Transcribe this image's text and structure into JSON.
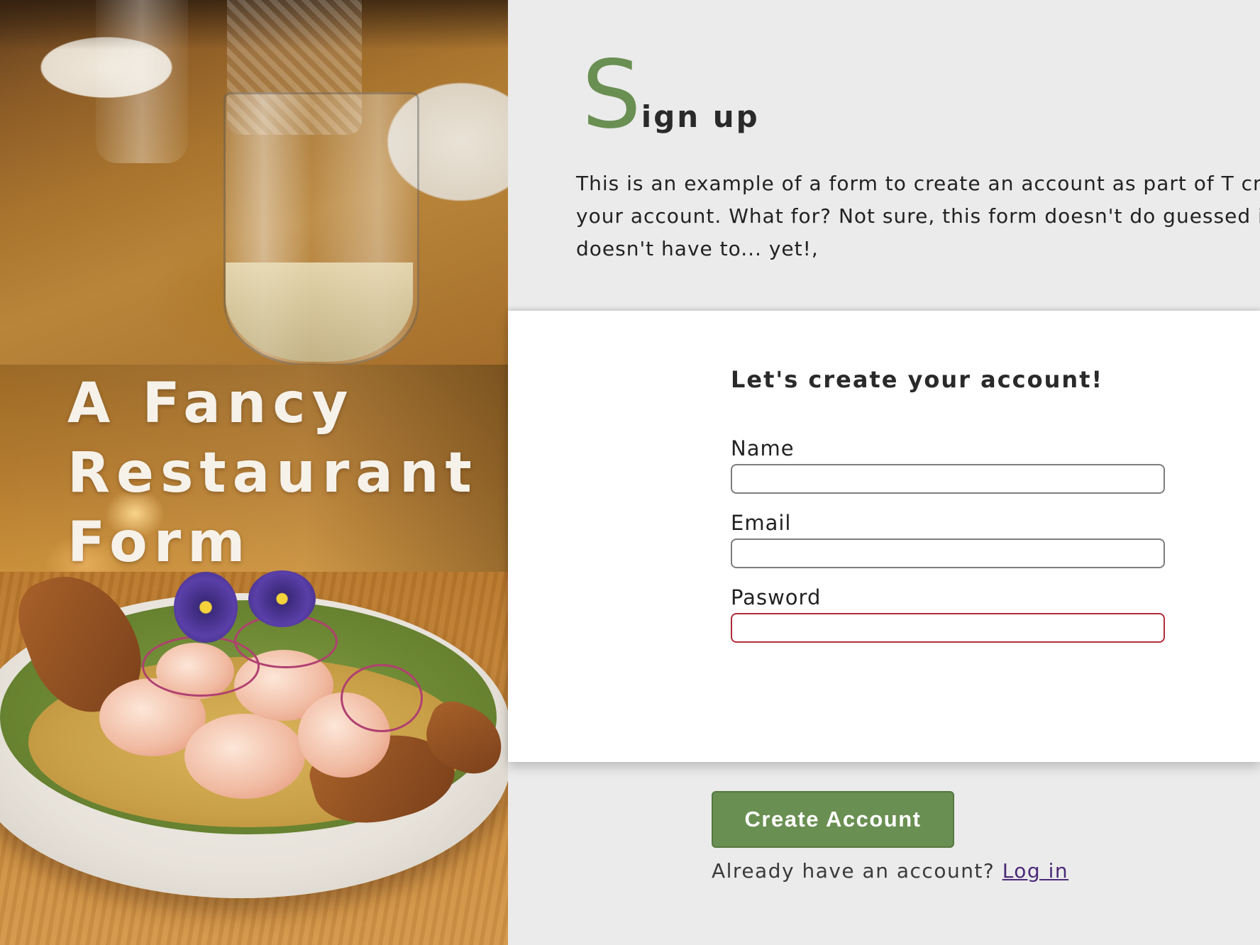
{
  "hero": {
    "title_line1": "A Fancy",
    "title_line2": "Restaurant",
    "title_line3": "Form"
  },
  "header": {
    "title_initial": "S",
    "title_rest": "ign up",
    "intro_text": "This is an example of a form to create an account as part of T create your account. What for? Not sure, this form doesn't do guessed it... it doesn't have to... yet!,"
  },
  "form": {
    "title": "Let's create your account!",
    "fields": [
      {
        "label": "Name",
        "value": "",
        "placeholder": ""
      },
      {
        "label": "Email",
        "value": "",
        "placeholder": ""
      },
      {
        "label": "Pasword",
        "value": "",
        "placeholder": ""
      }
    ]
  },
  "actions": {
    "create_label": "Create Account",
    "login_prompt": "Already have an account?",
    "login_link": "Log in"
  },
  "colors": {
    "accent": "#6a8f52",
    "invalid_border": "#b02c3a",
    "link": "#4b2a78",
    "panel_bg": "#ebebeb"
  },
  "images": {
    "top_photo": "wine-glass-on-table-photo",
    "bottom_photo": "shrimp-ceviche-bowl-photo"
  }
}
